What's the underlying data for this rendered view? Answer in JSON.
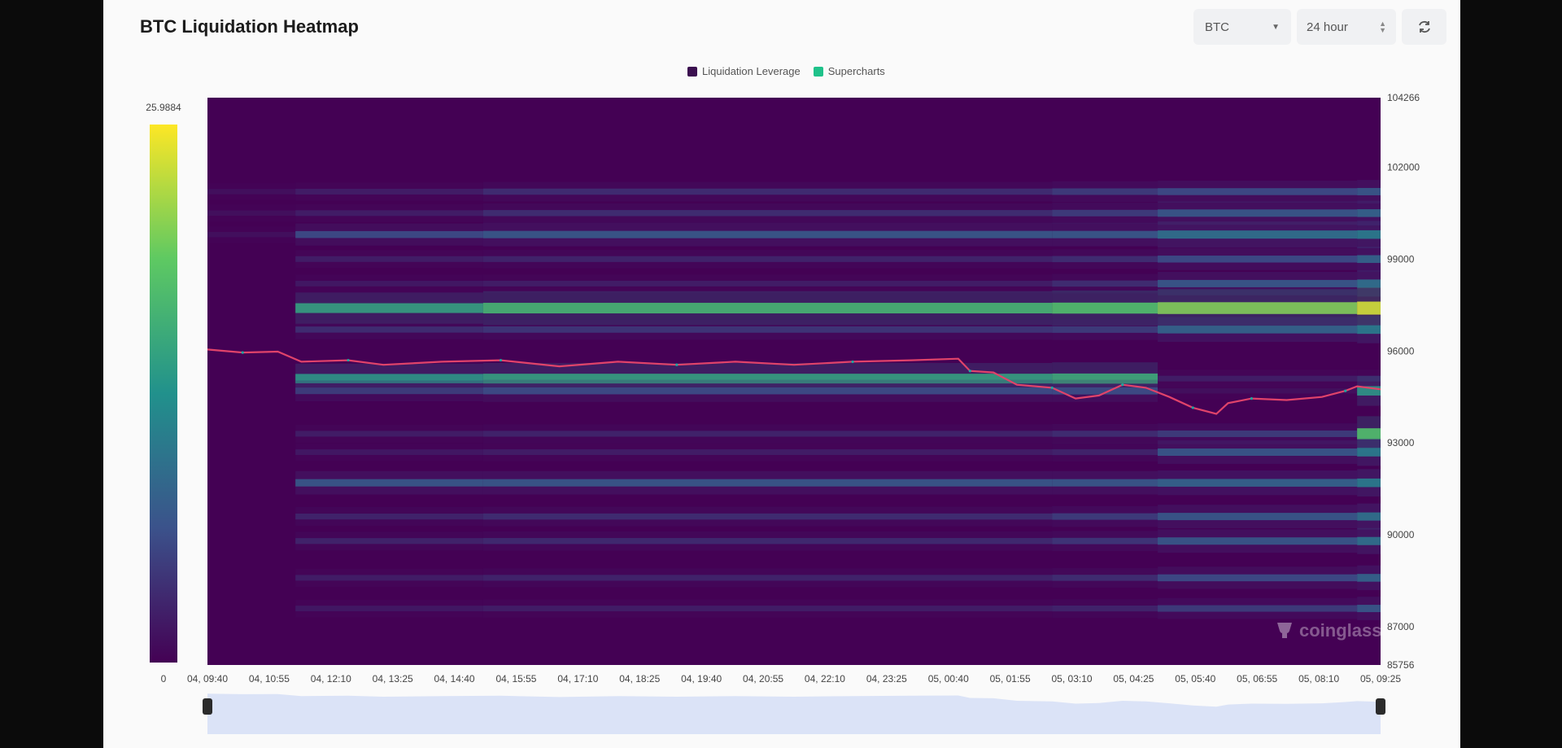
{
  "header": {
    "title": "BTC Liquidation Heatmap",
    "symbol": "BTC",
    "range": "24 hour"
  },
  "icons": {
    "refresh": "refresh-icon",
    "dropdown": "chevron-down-icon",
    "stepper": "up-down-icon",
    "logo": "coinglass-logo-icon"
  },
  "legend": [
    {
      "label": "Liquidation Leverage",
      "color": "#3b0f4f"
    },
    {
      "label": "Supercharts",
      "color": "#1fc28a"
    }
  ],
  "watermark": "coinglass",
  "colors": {
    "low": "#440154",
    "mid1": "#31688e",
    "mid2": "#21918c",
    "mid3": "#35b779",
    "high": "#fde725",
    "price_line": "#e0436a",
    "price_line_alt": "#1ea7a0",
    "navigator_fill": "#dbe3f7"
  },
  "chart_data": {
    "type": "heatmap",
    "title": "BTC Liquidation Heatmap",
    "colorbar": {
      "min_label": "0",
      "max_label": "25.9884",
      "min": 0,
      "max": 25.9884
    },
    "y_axis": {
      "min": 85756,
      "max": 104266,
      "tick_labels": [
        "104266",
        "102000",
        "99000",
        "96000",
        "93000",
        "90000",
        "87000",
        "85756"
      ],
      "tick_values": [
        104266,
        102000,
        99000,
        96000,
        93000,
        90000,
        87000,
        85756
      ]
    },
    "x_axis": {
      "tick_labels": [
        "04, 09:40",
        "04, 10:55",
        "04, 12:10",
        "04, 13:25",
        "04, 14:40",
        "04, 15:55",
        "04, 17:10",
        "04, 18:25",
        "04, 19:40",
        "04, 20:55",
        "04, 22:10",
        "04, 23:25",
        "05, 00:40",
        "05, 01:55",
        "05, 03:10",
        "05, 04:25",
        "05, 05:40",
        "05, 06:55",
        "05, 08:10",
        "05, 09:25"
      ]
    },
    "price_series": [
      {
        "t": 0.0,
        "price": 96050
      },
      {
        "t": 0.03,
        "price": 95950
      },
      {
        "t": 0.06,
        "price": 95980
      },
      {
        "t": 0.08,
        "price": 95650
      },
      {
        "t": 0.12,
        "price": 95700
      },
      {
        "t": 0.15,
        "price": 95550
      },
      {
        "t": 0.2,
        "price": 95650
      },
      {
        "t": 0.25,
        "price": 95700
      },
      {
        "t": 0.3,
        "price": 95500
      },
      {
        "t": 0.35,
        "price": 95650
      },
      {
        "t": 0.4,
        "price": 95550
      },
      {
        "t": 0.45,
        "price": 95650
      },
      {
        "t": 0.5,
        "price": 95550
      },
      {
        "t": 0.55,
        "price": 95650
      },
      {
        "t": 0.6,
        "price": 95700
      },
      {
        "t": 0.64,
        "price": 95750
      },
      {
        "t": 0.65,
        "price": 95350
      },
      {
        "t": 0.67,
        "price": 95300
      },
      {
        "t": 0.69,
        "price": 94900
      },
      {
        "t": 0.72,
        "price": 94800
      },
      {
        "t": 0.74,
        "price": 94450
      },
      {
        "t": 0.76,
        "price": 94550
      },
      {
        "t": 0.78,
        "price": 94900
      },
      {
        "t": 0.8,
        "price": 94800
      },
      {
        "t": 0.82,
        "price": 94500
      },
      {
        "t": 0.84,
        "price": 94150
      },
      {
        "t": 0.86,
        "price": 93950
      },
      {
        "t": 0.87,
        "price": 94300
      },
      {
        "t": 0.89,
        "price": 94450
      },
      {
        "t": 0.92,
        "price": 94400
      },
      {
        "t": 0.95,
        "price": 94500
      },
      {
        "t": 0.97,
        "price": 94700
      },
      {
        "t": 0.98,
        "price": 94850
      },
      {
        "t": 1.0,
        "price": 94750
      }
    ],
    "liquidation_bands": [
      {
        "price": 101200,
        "intensity": [
          0.05,
          0.1,
          0.15,
          0.2,
          0.25,
          0.3
        ]
      },
      {
        "price": 100500,
        "intensity": [
          0.05,
          0.1,
          0.15,
          0.2,
          0.3,
          0.35
        ]
      },
      {
        "price": 99800,
        "intensity": [
          0.05,
          0.25,
          0.3,
          0.3,
          0.4,
          0.45
        ]
      },
      {
        "price": 99000,
        "intensity": [
          0.03,
          0.1,
          0.12,
          0.15,
          0.25,
          0.35
        ]
      },
      {
        "price": 98200,
        "intensity": [
          0.03,
          0.08,
          0.1,
          0.15,
          0.3,
          0.4
        ]
      },
      {
        "price": 97400,
        "intensity": [
          0.03,
          0.6,
          0.7,
          0.75,
          0.85,
          1.0
        ]
      },
      {
        "price": 96700,
        "intensity": [
          0.02,
          0.15,
          0.18,
          0.2,
          0.35,
          0.45
        ]
      },
      {
        "price": 95100,
        "intensity": [
          0.02,
          0.55,
          0.6,
          0.65,
          0.1,
          0.1
        ]
      },
      {
        "price": 94700,
        "intensity": [
          0.02,
          0.2,
          0.25,
          0.25,
          0.05,
          0.55
        ]
      },
      {
        "price": 93300,
        "intensity": [
          0.02,
          0.1,
          0.12,
          0.15,
          0.2,
          0.75
        ]
      },
      {
        "price": 92700,
        "intensity": [
          0.02,
          0.08,
          0.1,
          0.12,
          0.3,
          0.45
        ]
      },
      {
        "price": 91700,
        "intensity": [
          0.02,
          0.3,
          0.3,
          0.3,
          0.35,
          0.45
        ]
      },
      {
        "price": 90600,
        "intensity": [
          0.02,
          0.12,
          0.15,
          0.2,
          0.3,
          0.4
        ]
      },
      {
        "price": 89800,
        "intensity": [
          0.02,
          0.12,
          0.14,
          0.18,
          0.3,
          0.4
        ]
      },
      {
        "price": 88600,
        "intensity": [
          0.02,
          0.1,
          0.12,
          0.15,
          0.25,
          0.35
        ]
      },
      {
        "price": 87600,
        "intensity": [
          0.02,
          0.08,
          0.1,
          0.12,
          0.2,
          0.3
        ]
      }
    ],
    "segment_breaks": [
      0,
      0.075,
      0.235,
      0.72,
      0.81,
      0.98,
      1.0
    ],
    "navigator": {
      "start": 0,
      "end": 1
    }
  }
}
